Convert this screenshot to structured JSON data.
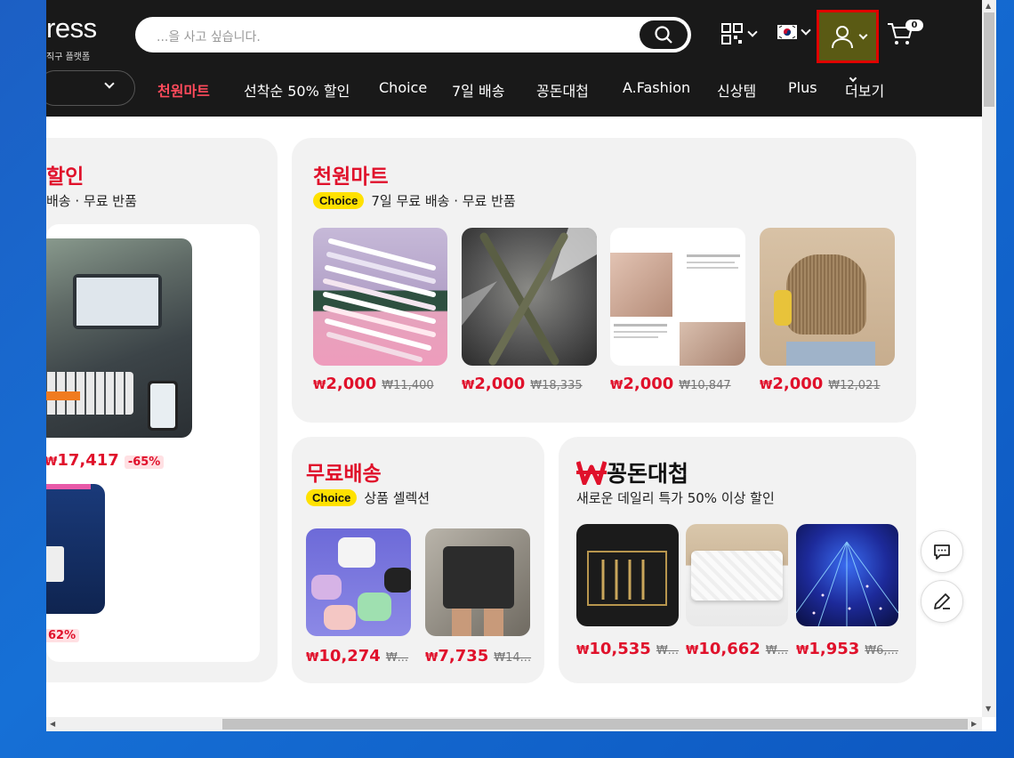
{
  "header": {
    "logo": "ress",
    "logo_sub": "직구 플랫폼",
    "search_placeholder": "...을 사고 싶습니다.",
    "cart_count": "0",
    "nav": [
      "천원마트",
      "선착순 50% 할인",
      "Choice",
      "7일 배송",
      "꽁돈대첩",
      "A.Fashion",
      "신상템",
      "Plus",
      "더보기"
    ]
  },
  "card_left": {
    "title": "할인",
    "subtitle": "배송 · 무료 반품",
    "products": [
      {
        "price": "17,417",
        "discount": "-65%"
      },
      {
        "discount": "62%"
      }
    ]
  },
  "card_cheonwon": {
    "title": "천원마트",
    "badge": "Choice",
    "subtitle": "7일 무료 배송 · 무료 반품",
    "products": [
      {
        "price": "2,000",
        "old": "₩11,400"
      },
      {
        "price": "2,000",
        "old": "₩18,335"
      },
      {
        "price": "2,000",
        "old": "₩10,847"
      },
      {
        "price": "2,000",
        "old": "₩12,021"
      }
    ]
  },
  "card_free": {
    "title": "무료배송",
    "badge": "Choice",
    "subtitle": "상품 셀렉션",
    "products": [
      {
        "price": "10,274",
        "old": "₩..."
      },
      {
        "price": "7,735",
        "old": "₩14..."
      }
    ]
  },
  "card_kkongdon": {
    "title": "꽁돈대첩",
    "subtitle": "새로운 데일리 특가 50% 이상 할인",
    "products": [
      {
        "price": "10,535",
        "old": "₩..."
      },
      {
        "price": "10,662",
        "old": "₩..."
      },
      {
        "price": "1,953",
        "old": "₩6,..."
      }
    ]
  },
  "won": "₩",
  "colors": {
    "accent": "#e0112b",
    "choice": "#ffe100",
    "header": "#191919"
  }
}
